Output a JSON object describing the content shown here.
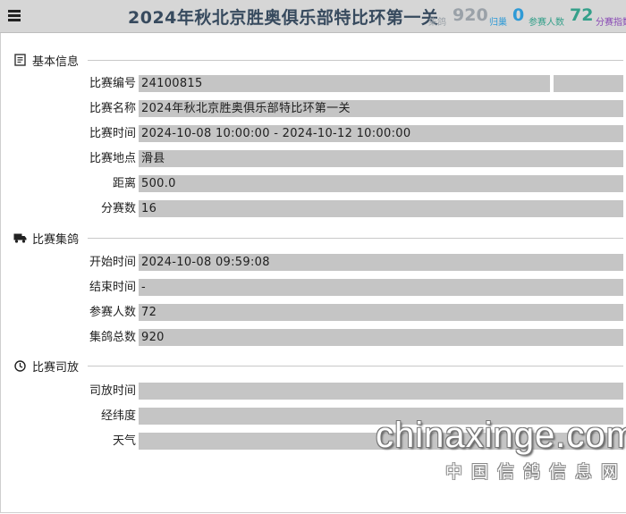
{
  "header": {
    "title": "2024年秋北京胜奥俱乐部特比环第一关",
    "stats": [
      {
        "label": "集鸽",
        "value": "920"
      },
      {
        "label": "归巢",
        "value": "0"
      },
      {
        "label": "参赛人数",
        "value": "72"
      },
      {
        "label": "分赛指数",
        "value": ""
      }
    ]
  },
  "sections": [
    {
      "title": "基本信息",
      "icon": "document-icon",
      "rows": [
        {
          "label": "比赛编号",
          "value": "24100815"
        },
        {
          "label": "比赛名称",
          "value": "2024年秋北京胜奥俱乐部特比环第一关"
        },
        {
          "label": "比赛时间",
          "value": "2024-10-08 10:00:00 - 2024-10-12 10:00:00"
        },
        {
          "label": "比赛地点",
          "value": "滑县"
        },
        {
          "label": "距离",
          "value": "500.0"
        },
        {
          "label": "分赛数",
          "value": "16"
        }
      ]
    },
    {
      "title": "比赛集鸽",
      "icon": "truck-icon",
      "rows": [
        {
          "label": "开始时间",
          "value": "2024-10-08 09:59:08"
        },
        {
          "label": "结束时间",
          "value": "-"
        },
        {
          "label": "参赛人数",
          "value": "72"
        },
        {
          "label": "集鸽总数",
          "value": "920"
        }
      ]
    },
    {
      "title": "比赛司放",
      "icon": "clock-icon",
      "rows": [
        {
          "label": "司放时间",
          "value": ""
        },
        {
          "label": "经纬度",
          "value": ""
        },
        {
          "label": "天气",
          "value": ""
        }
      ]
    }
  ],
  "watermark": {
    "brand": "chinaxinge.com",
    "subtitle": "中国信鸽信息网"
  },
  "colors": {
    "topbar_bg": "#d6d6d6",
    "title": "#374a5e",
    "stat_grey": "#9aa1a8",
    "stat_blue": "#2f9ad6",
    "stat_green": "#35a08a",
    "field_bg": "#c5c5c5"
  }
}
